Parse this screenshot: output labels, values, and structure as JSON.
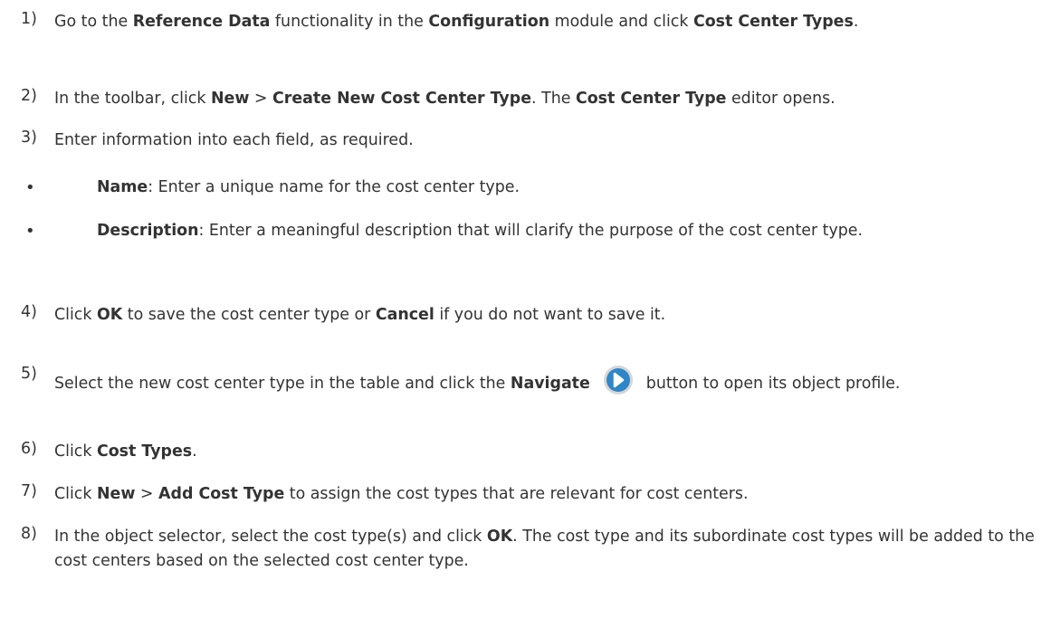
{
  "steps": [
    {
      "num": "1)",
      "parts": [
        {
          "t": "Go to the "
        },
        {
          "b": "Reference Data"
        },
        {
          "t": " functionality in the "
        },
        {
          "b": "Configuration"
        },
        {
          "t": " module and click "
        },
        {
          "b": "Cost Center Types"
        },
        {
          "t": "."
        }
      ]
    },
    {
      "num": "2)",
      "parts": [
        {
          "t": "In the toolbar, click "
        },
        {
          "b": "New"
        },
        {
          "t": " > "
        },
        {
          "b": "Create New Cost Center Type"
        },
        {
          "t": ". The "
        },
        {
          "b": "Cost Center Type"
        },
        {
          "t": " editor opens."
        }
      ]
    },
    {
      "num": "3)",
      "parts": [
        {
          "t": "Enter information into each field, as required."
        }
      ],
      "bullets": [
        {
          "parts": [
            {
              "b": "Name"
            },
            {
              "t": ": Enter a unique name for the cost center type."
            }
          ]
        },
        {
          "parts": [
            {
              "b": "Description"
            },
            {
              "t": ": Enter a meaningful description that will clarify the purpose of the cost center type."
            }
          ]
        }
      ]
    },
    {
      "num": "4)",
      "parts": [
        {
          "t": "Click "
        },
        {
          "b": "OK"
        },
        {
          "t": " to save the cost center type or "
        },
        {
          "b": "Cancel"
        },
        {
          "t": " if you do not want to save it."
        }
      ]
    },
    {
      "num": "5)",
      "parts": [
        {
          "t": "Select the new cost center type in the table and click the "
        },
        {
          "b": "Navigate"
        },
        {
          "icon": "navigate-arrow-icon"
        },
        {
          "t": "button to open its object profile."
        }
      ]
    },
    {
      "num": "6)",
      "parts": [
        {
          "t": "Click "
        },
        {
          "b": "Cost Types"
        },
        {
          "t": "."
        }
      ]
    },
    {
      "num": "7)",
      "parts": [
        {
          "t": "Click "
        },
        {
          "b": "New"
        },
        {
          "t": " > "
        },
        {
          "b": "Add Cost Type"
        },
        {
          "t": " to assign the cost types that are relevant for cost centers."
        }
      ]
    },
    {
      "num": "8)",
      "parts": [
        {
          "t": "In the object selector, select the cost type(s) and click "
        },
        {
          "b": "OK"
        },
        {
          "t": ". The cost type and its subordinate cost types will be added to the cost centers based on the selected cost center type."
        }
      ]
    }
  ],
  "bullet_glyph": "•",
  "colors": {
    "text": "#333333",
    "icon_fill": "#2f86c7",
    "icon_ring": "#d6d6d6"
  }
}
